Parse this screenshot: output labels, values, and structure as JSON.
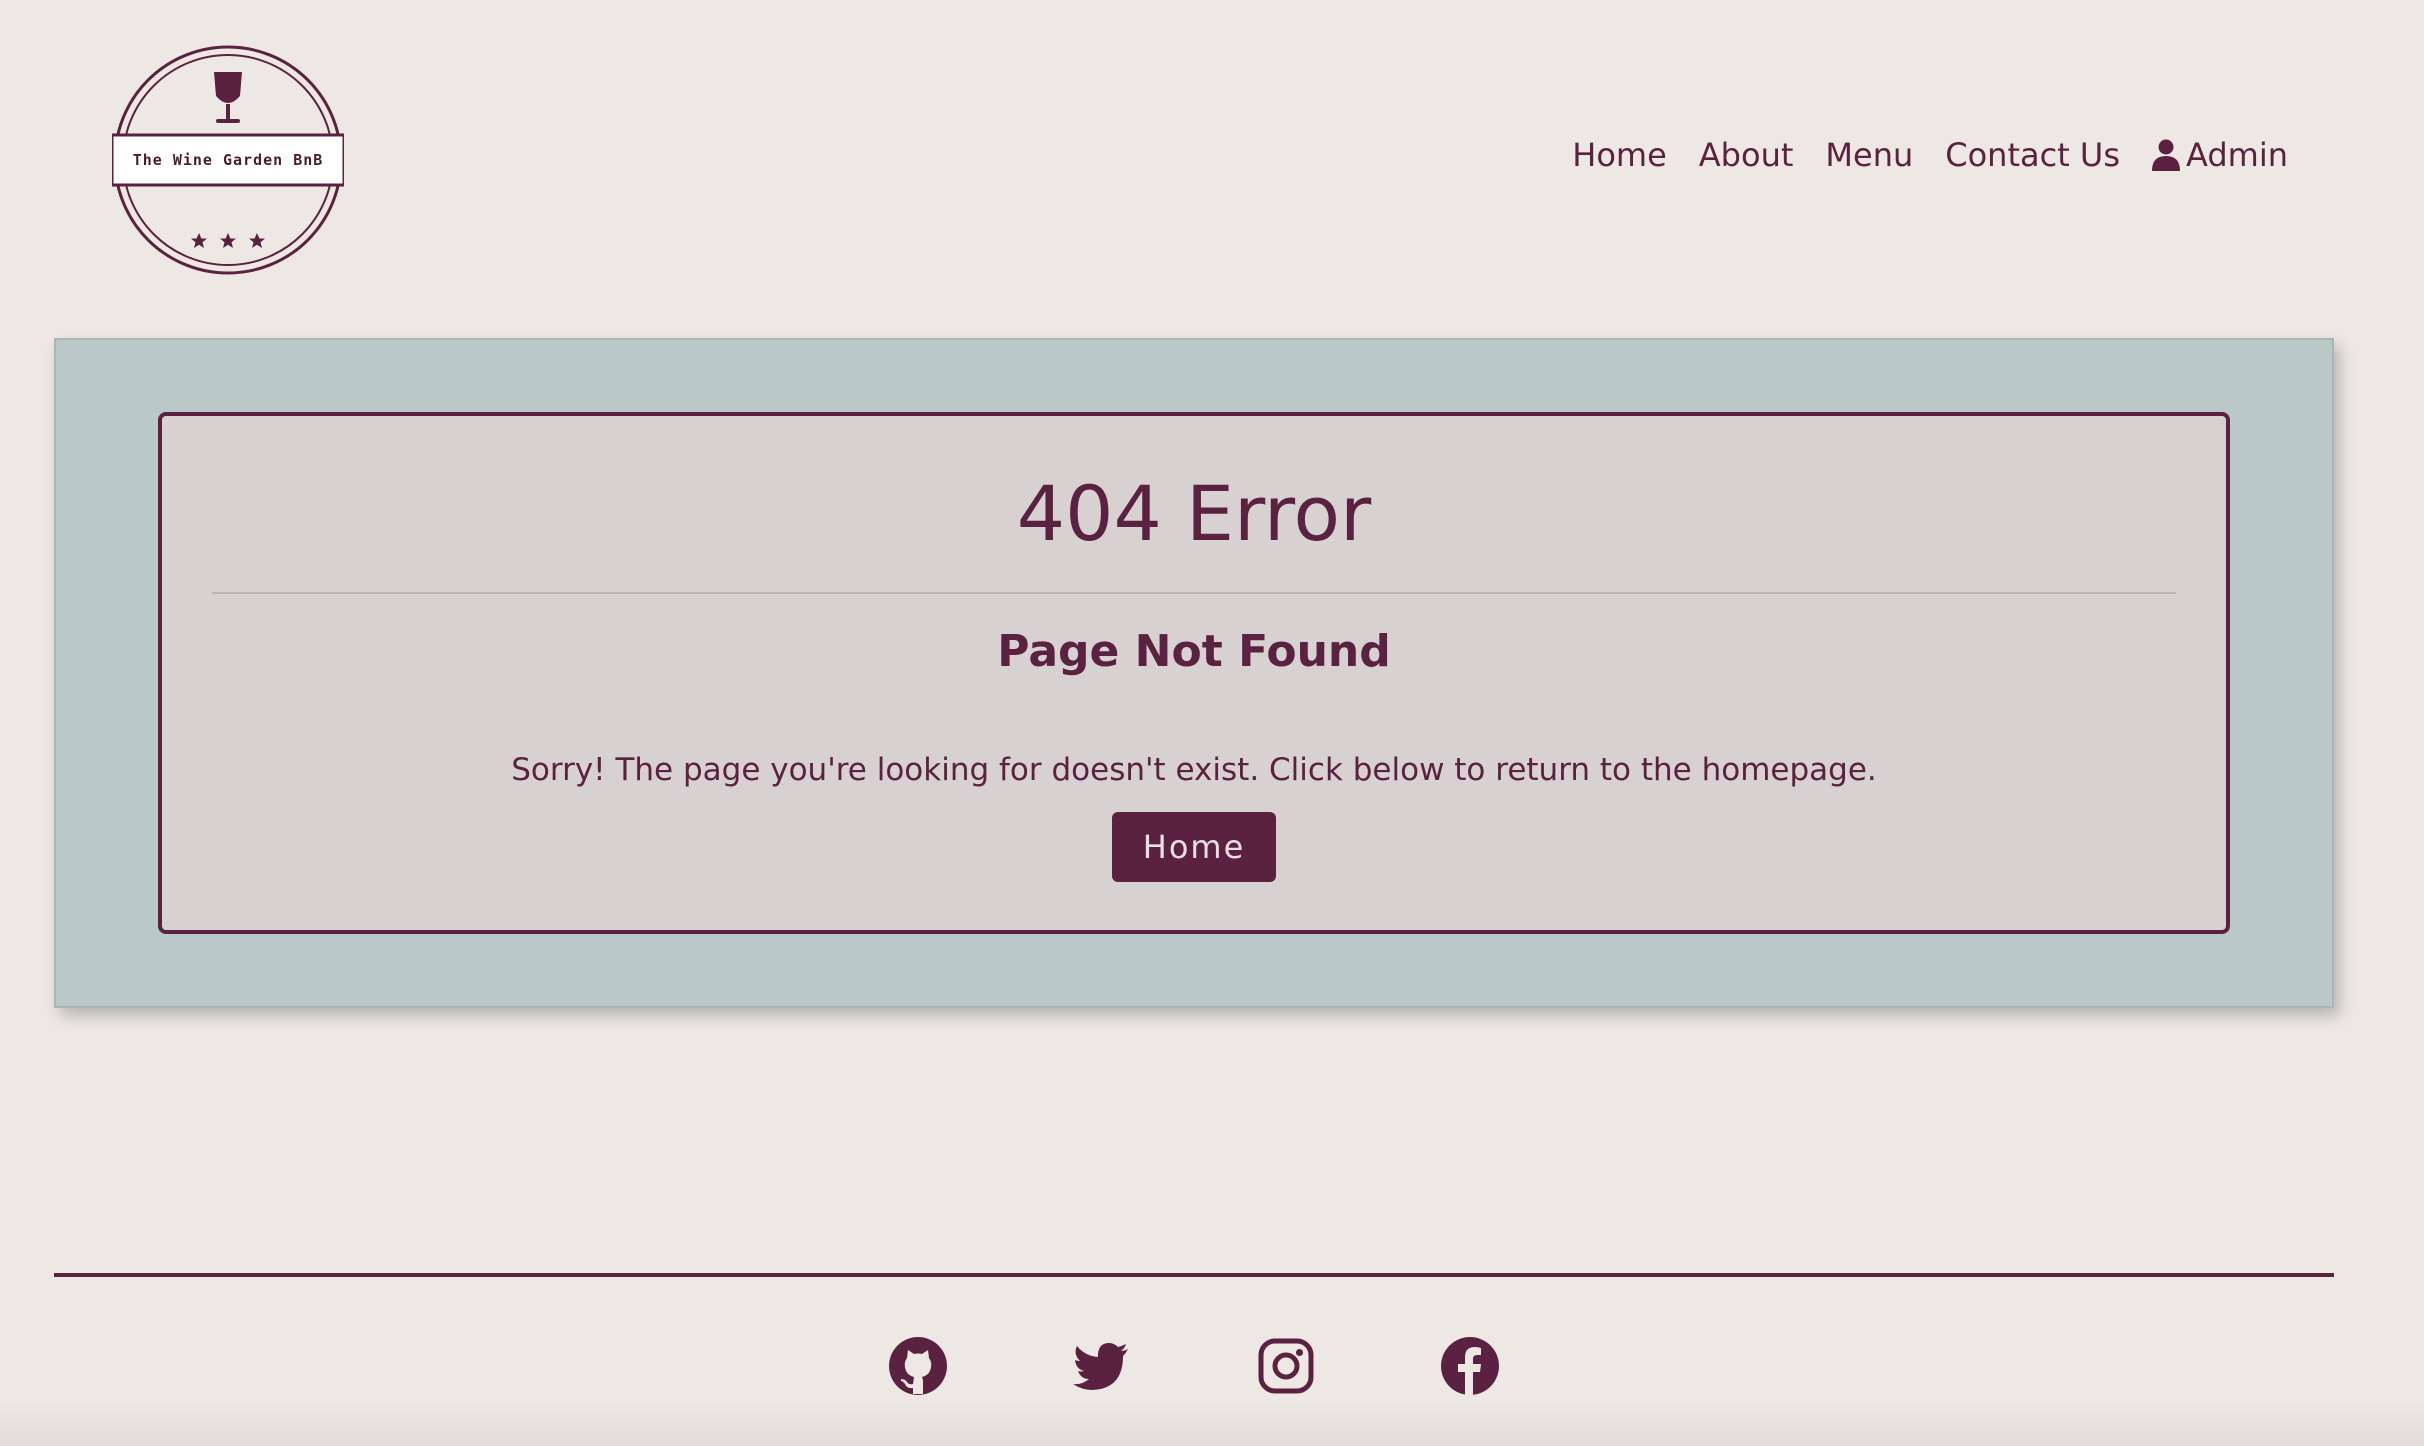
{
  "brand": {
    "logo_text": "The Wine Garden BnB",
    "logo_icon": "wine-glass-icon",
    "stars_icon": "star-icon"
  },
  "nav": {
    "items": [
      {
        "label": "Home"
      },
      {
        "label": "About"
      },
      {
        "label": "Menu"
      },
      {
        "label": "Contact Us"
      }
    ],
    "admin": {
      "label": "Admin",
      "icon": "user-icon"
    }
  },
  "error": {
    "title": "404 Error",
    "subtitle": "Page Not Found",
    "message": "Sorry! The page you're looking for doesn't exist. Click below to return to the homepage.",
    "button_label": "Home"
  },
  "footer": {
    "socials": [
      {
        "icon": "github-icon"
      },
      {
        "icon": "twitter-icon"
      },
      {
        "icon": "instagram-icon"
      },
      {
        "icon": "facebook-icon"
      }
    ]
  },
  "colors": {
    "background": "#ede8e3",
    "accent": "#5a2240",
    "panel": "#bac8c8",
    "card": "#d8d1d1"
  }
}
